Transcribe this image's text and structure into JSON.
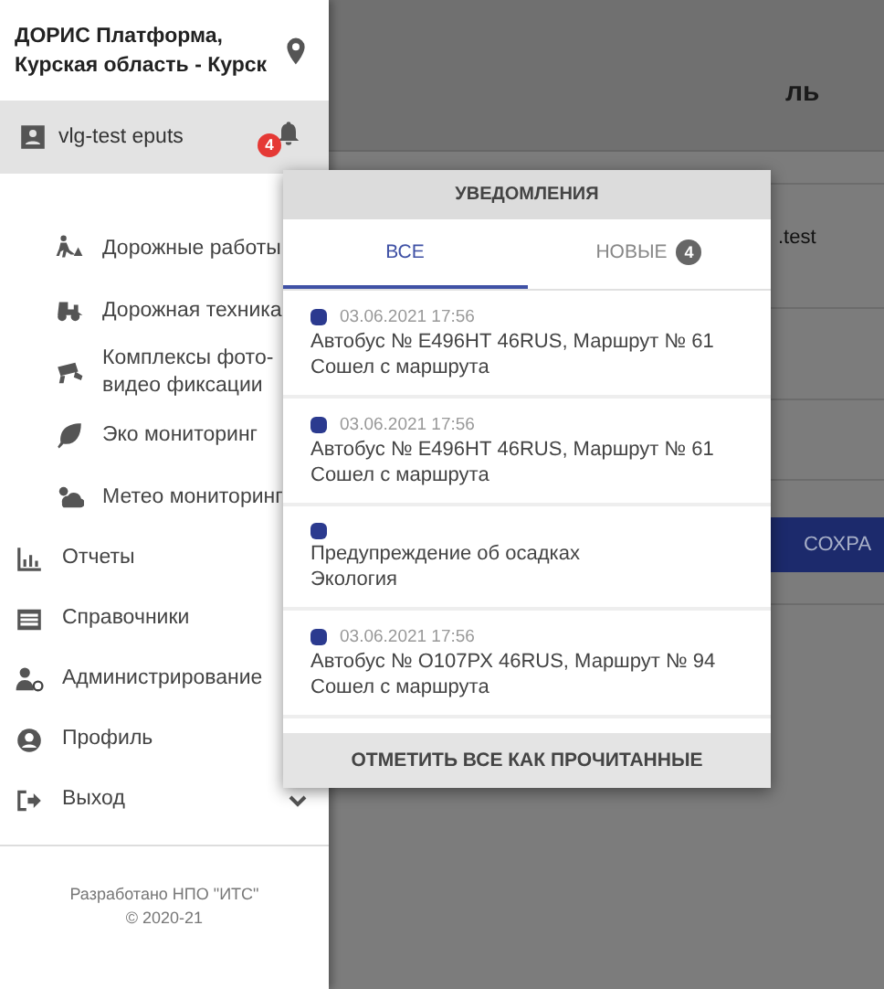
{
  "sidebar": {
    "title": "ДОРИС Платформа, Курская область - Курск",
    "user": "vlg-test eputs",
    "notification_badge": "4",
    "items": [
      {
        "kind": "sub",
        "label": "Дорожные работы"
      },
      {
        "kind": "sub",
        "label": "Дорожная техника"
      },
      {
        "kind": "sub",
        "label": "Комплексы фото-видео фиксации"
      },
      {
        "kind": "sub",
        "label": "Эко мониторинг"
      },
      {
        "kind": "sub",
        "label": "Метео мониторинг"
      },
      {
        "kind": "main",
        "label": "Отчеты"
      },
      {
        "kind": "main",
        "label": "Справочники"
      },
      {
        "kind": "main",
        "label": "Администрирование"
      },
      {
        "kind": "main",
        "label": "Профиль"
      },
      {
        "kind": "main",
        "label": "Выход"
      }
    ],
    "footer": [
      "Разработано НПО \"ИТС\"",
      "© 2020-21"
    ]
  },
  "background": {
    "heading": "ль",
    "text": ".test",
    "button": "СОХРА"
  },
  "notifications": {
    "title": "УВЕДОМЛЕНИЯ",
    "tabs": [
      {
        "label": "ВСЕ",
        "selected": true
      },
      {
        "label": "НОВЫЕ",
        "selected": false,
        "badge": "4"
      }
    ],
    "items": [
      {
        "color": "#2b3a8f",
        "date": "03.06.2021 17:56",
        "title": "Автобус № Е496НТ 46RUS, Маршрут № 61",
        "subtitle": "Сошел с маршрута"
      },
      {
        "color": "#2b3a8f",
        "date": "03.06.2021 17:56",
        "title": "Автобус № Е496НТ 46RUS, Маршрут № 61",
        "subtitle": "Сошел с маршрута"
      },
      {
        "color": "#2b3a8f",
        "title": "Предупреждение об осадках",
        "subtitle": "Экология"
      },
      {
        "color": "#2b3a8f",
        "date": "03.06.2021 17:56",
        "title": "Автобус № О107РХ 46RUS, Маршрут № 94",
        "subtitle": "Сошел с маршрута"
      }
    ],
    "mark_all_button": "ОТМЕТИТЬ ВСЕ КАК ПРОЧИТАННЫЕ"
  }
}
